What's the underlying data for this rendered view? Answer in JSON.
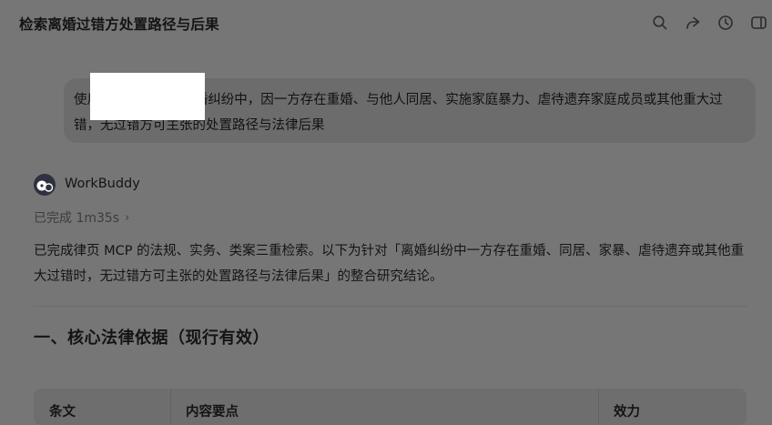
{
  "header": {
    "title": "检索离婚过错方处置路径与后果",
    "icons": [
      "search-icon",
      "share-icon",
      "history-icon",
      "panel-icon"
    ]
  },
  "user_message": {
    "text": "使用律页mcp检索离婚纠纷中，因一方存在重婚、与他人同居、实施家庭暴力、虐待遗弃家庭成员或其他重大过错，无过错方可主张的处置路径与法律后果"
  },
  "agent": {
    "name": "WorkBuddy",
    "status": "已完成 1m35s",
    "status_chevron": "›"
  },
  "answer": {
    "intro": "已完成律页 MCP 的法规、实务、类案三重检索。以下为针对「离婚纠纷中一方存在重婚、同居、家暴、虐待遗弃或其他重大过错时，无过错方可主张的处置路径与法律后果」的整合研究结论。",
    "section_title": "一、核心法律依据（现行有效）",
    "table": {
      "headers": [
        "条文",
        "内容要点",
        "效力"
      ]
    }
  },
  "colors": {
    "background": "#767676",
    "bubble": "#6c6c6c",
    "highlight": "#ffffff"
  }
}
